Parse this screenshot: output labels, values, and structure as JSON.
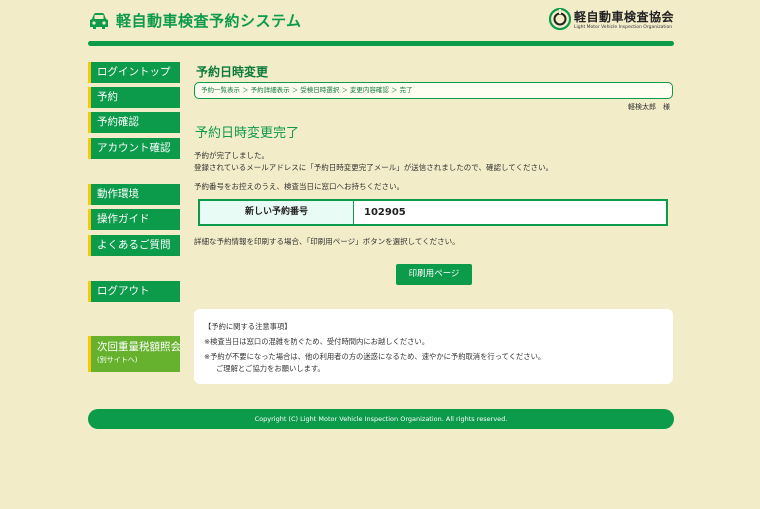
{
  "header": {
    "app_title": "軽自動車検査予約システム",
    "org_name": "軽自動車検査協会",
    "org_sub": "Light Motor Vehicle Inspection Organization"
  },
  "sidebar": {
    "items": [
      {
        "label": "ログイントップ"
      },
      {
        "label": "予約"
      },
      {
        "label": "予約確認"
      },
      {
        "label": "アカウント確認"
      },
      {
        "label": "動作環境"
      },
      {
        "label": "操作ガイド"
      },
      {
        "label": "よくあるご質問"
      },
      {
        "label": "ログアウト"
      }
    ],
    "tax": {
      "label": "次回重量税額照会",
      "sub": "(別サイトへ)"
    }
  },
  "main": {
    "page_title": "予約日時変更",
    "breadcrumb": "予約一覧表示 ＞ 予約詳細表示 ＞ 受検日時選択 ＞ 変更内容確認 ＞ 完了",
    "username": "軽検太郎　様",
    "complete_title": "予約日時変更完了",
    "messages": {
      "line1": "予約が完了しました。",
      "line2": "登録されているメールアドレスに「予約日時変更完了メール」が送信されましたので、確認してください。",
      "line3": "予約番号をお控えのうえ、検査当日に窓口へお持ちください。",
      "line4": "詳細な予約情報を印刷する場合、「印刷用ページ」ボタンを選択してください。"
    },
    "result": {
      "label": "新しい予約番号",
      "value": "102905"
    },
    "print_button": "印刷用ページ",
    "notes": {
      "heading": "【予約に関する注意事項】",
      "note1": "※検査当日は窓口の混雑を防ぐため、受付時間内にお越しください。",
      "note2": "※予約が不要になった場合は、他の利用者の方の迷惑になるため、速やかに予約取消を行ってください。",
      "note3": "ご理解とご協力をお願いします。"
    }
  },
  "footer": {
    "copyright": "Copyright (C) Light Motor Vehicle Inspection Organization. All rights reserved."
  },
  "colors": {
    "brand_green": "#0c9a4b",
    "background": "#f2ecc9",
    "accent_yellow": "#f6c90e",
    "tax_green": "#66b22e"
  },
  "icons": {
    "logo": "car-icon",
    "org": "org-mark-icon"
  }
}
